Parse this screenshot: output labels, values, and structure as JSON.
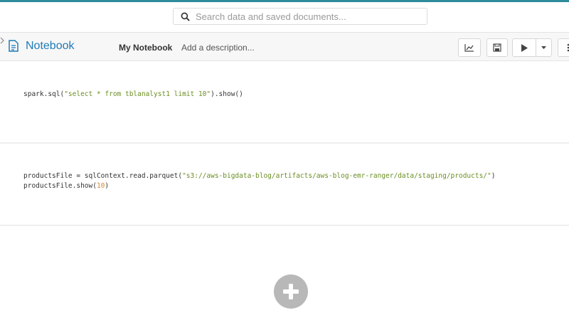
{
  "search": {
    "placeholder": "Search data and saved documents..."
  },
  "header": {
    "title": "Notebook",
    "name": "My Notebook",
    "description_placeholder": "Add a description..."
  },
  "toolbar": {
    "icons": [
      "chart-icon",
      "save-icon",
      "play-icon",
      "caret-down-icon",
      "more-icon"
    ]
  },
  "cells": [
    {
      "code_lines": [
        [
          {
            "t": "spark.sql(",
            "c": "plain"
          },
          {
            "t": "\"select * from tblanalyst1 limit 10\"",
            "c": "str"
          },
          {
            "t": ").show()",
            "c": "plain"
          }
        ]
      ]
    },
    {
      "code_lines": [
        [
          {
            "t": "productsFile = sqlContext.read.parquet(",
            "c": "plain"
          },
          {
            "t": "\"s3://aws-bigdata-blog/artifacts/aws-blog-emr-ranger/data/staging/products/\"",
            "c": "str"
          },
          {
            "t": ")",
            "c": "plain"
          }
        ],
        [
          {
            "t": "productsFile.show(",
            "c": "plain"
          },
          {
            "t": "10",
            "c": "num"
          },
          {
            "t": ")",
            "c": "plain"
          }
        ]
      ]
    }
  ],
  "colors": {
    "accent": "#1f7bb8",
    "string": "#6b8e23",
    "number": "#d7882c",
    "top_strip": "#2e8c9c",
    "add_button": "#b8b8b8"
  }
}
